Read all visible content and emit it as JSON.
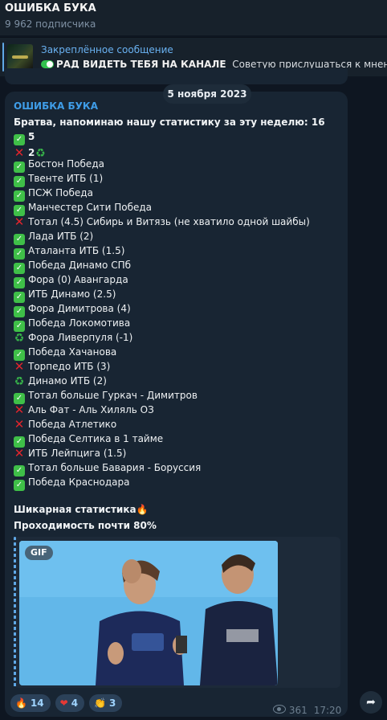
{
  "header": {
    "title": "ОШИБКА БУКА",
    "subscribers": "9 962 подписчика"
  },
  "pinned": {
    "label": "Закреплённое сообщение",
    "bold": "РАД ВИДЕТЬ ТЕБЯ НА КАНАЛЕ",
    "rest": "Советую прислушаться к мнению"
  },
  "date": "5 ноября 2023",
  "message": {
    "author": "ОШИБКА БУКА",
    "intro_text": "Братва, напоминаю нашу статистику за эту неделю: 16",
    "win_count": "5",
    "loss_count": "2",
    "items": [
      {
        "status": "win",
        "text": "Бостон Победа"
      },
      {
        "status": "win",
        "text": "Твенте ИТБ (1)"
      },
      {
        "status": "win",
        "text": "ПСЖ Победа"
      },
      {
        "status": "win",
        "text": "Манчестер Сити Победа"
      },
      {
        "status": "loss",
        "text": "Тотал (4.5) Сибирь и Витязь (не хватило одной шайбы)"
      },
      {
        "status": "win",
        "text": "Лада ИТБ (2)"
      },
      {
        "status": "win",
        "text": "Аталанта ИТБ (1.5)"
      },
      {
        "status": "win",
        "text": "Победа Динамо СПб"
      },
      {
        "status": "win",
        "text": "Фора (0) Авангарда"
      },
      {
        "status": "win",
        "text": "ИТБ Динамо (2.5)"
      },
      {
        "status": "win",
        "text": "Фора Димитрова (4)"
      },
      {
        "status": "win",
        "text": "Победа Локомотива"
      },
      {
        "status": "refund",
        "text": "Фора Ливерпуля (-1)"
      },
      {
        "status": "win",
        "text": "Победа Хачанова"
      },
      {
        "status": "loss",
        "text": "Торпедо ИТБ (3)"
      },
      {
        "status": "refund",
        "text": "Динамо ИТБ (2)"
      },
      {
        "status": "win",
        "text": "Тотал больше Гуркач - Димитров"
      },
      {
        "status": "loss",
        "text": "Аль Фат - Аль Хиляль ОЗ"
      },
      {
        "status": "loss",
        "text": "Победа Атлетико"
      },
      {
        "status": "win",
        "text": "Победа Селтика в 1 тайме"
      },
      {
        "status": "loss",
        "text": "ИТБ Лейпцига (1.5)"
      },
      {
        "status": "win",
        "text": "Тотал больше Бавария - Боруссия"
      },
      {
        "status": "win",
        "text": "Победа Краснодара"
      }
    ],
    "stat_line1": "Шикарная статистика",
    "stat_line2": "Проходимость почти 80%",
    "gif_label": "GIF"
  },
  "reactions": [
    {
      "icon": "fire-icon",
      "glyph": "🔥",
      "count": "14",
      "color": "#ff7a1a"
    },
    {
      "icon": "heart-icon",
      "glyph": "❤",
      "count": "4",
      "color": "#e53935"
    },
    {
      "icon": "clap-icon",
      "glyph": "👏",
      "count": "3",
      "color": "#f3c34f"
    }
  ],
  "views": "361",
  "time": "17:20"
}
